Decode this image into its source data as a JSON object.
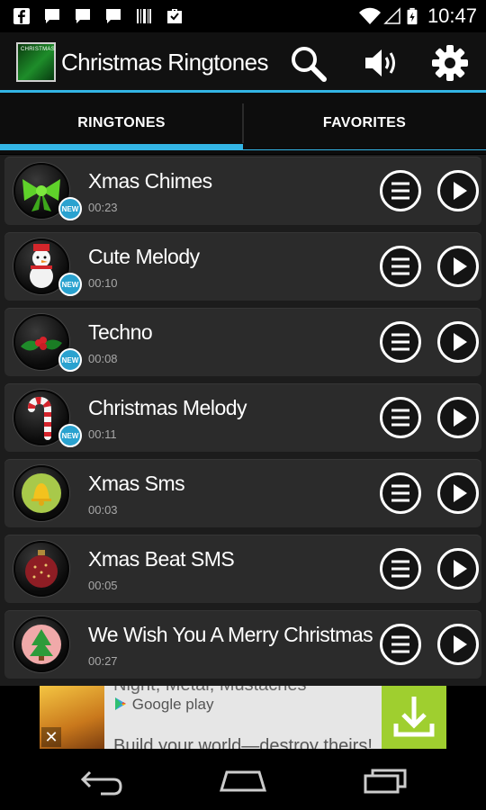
{
  "status_bar": {
    "time": "10:47",
    "icons": [
      "facebook-icon",
      "message-icon",
      "message-icon",
      "message-icon",
      "barcode-icon",
      "briefcase-icon",
      "wifi-icon",
      "signal-icon",
      "battery-charging-icon"
    ]
  },
  "app_bar": {
    "icon_text": "CHRISTMAS",
    "title": "Christmas Ringtones",
    "actions": [
      "search-icon",
      "volume-icon",
      "settings-icon"
    ]
  },
  "tabs": [
    {
      "label": "RINGTONES",
      "selected": true
    },
    {
      "label": "FAVORITES",
      "selected": false
    }
  ],
  "ringtones": [
    {
      "title": "Xmas Chimes",
      "duration": "00:23",
      "badge": "NEW",
      "image": "green-bow"
    },
    {
      "title": "Cute Melody",
      "duration": "00:10",
      "badge": "NEW",
      "image": "snowman"
    },
    {
      "title": "Techno",
      "duration": "00:08",
      "badge": "NEW",
      "image": "holly"
    },
    {
      "title": "Christmas Melody",
      "duration": "00:11",
      "badge": "NEW",
      "image": "candy-cane"
    },
    {
      "title": "Xmas Sms",
      "duration": "00:03",
      "badge": "",
      "image": "bell"
    },
    {
      "title": "Xmas Beat SMS",
      "duration": "00:05",
      "badge": "",
      "image": "ornament"
    },
    {
      "title": "We Wish You A Merry Christmas",
      "duration": "00:27",
      "badge": "",
      "image": "tree"
    }
  ],
  "ad": {
    "top_text": "Night, Metal, Mustaches",
    "store_label": "Google play",
    "bottom_text": "Build your world—destroy theirs!",
    "close_label": "✕"
  },
  "colors": {
    "accent": "#33b5e5",
    "row_bg": "#2b2b2b",
    "list_bg": "#1c1c1c",
    "download_green": "#9fcf2f"
  }
}
